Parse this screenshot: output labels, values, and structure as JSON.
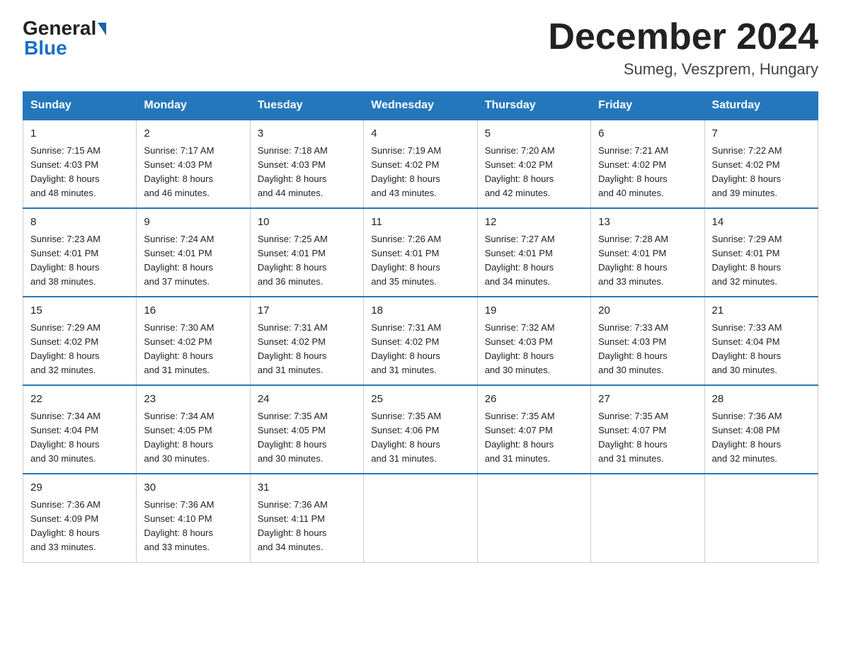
{
  "header": {
    "logo_general": "General",
    "logo_blue": "Blue",
    "title": "December 2024",
    "location": "Sumeg, Veszprem, Hungary"
  },
  "days_of_week": [
    "Sunday",
    "Monday",
    "Tuesday",
    "Wednesday",
    "Thursday",
    "Friday",
    "Saturday"
  ],
  "weeks": [
    [
      {
        "day": "1",
        "info": "Sunrise: 7:15 AM\nSunset: 4:03 PM\nDaylight: 8 hours\nand 48 minutes."
      },
      {
        "day": "2",
        "info": "Sunrise: 7:17 AM\nSunset: 4:03 PM\nDaylight: 8 hours\nand 46 minutes."
      },
      {
        "day": "3",
        "info": "Sunrise: 7:18 AM\nSunset: 4:03 PM\nDaylight: 8 hours\nand 44 minutes."
      },
      {
        "day": "4",
        "info": "Sunrise: 7:19 AM\nSunset: 4:02 PM\nDaylight: 8 hours\nand 43 minutes."
      },
      {
        "day": "5",
        "info": "Sunrise: 7:20 AM\nSunset: 4:02 PM\nDaylight: 8 hours\nand 42 minutes."
      },
      {
        "day": "6",
        "info": "Sunrise: 7:21 AM\nSunset: 4:02 PM\nDaylight: 8 hours\nand 40 minutes."
      },
      {
        "day": "7",
        "info": "Sunrise: 7:22 AM\nSunset: 4:02 PM\nDaylight: 8 hours\nand 39 minutes."
      }
    ],
    [
      {
        "day": "8",
        "info": "Sunrise: 7:23 AM\nSunset: 4:01 PM\nDaylight: 8 hours\nand 38 minutes."
      },
      {
        "day": "9",
        "info": "Sunrise: 7:24 AM\nSunset: 4:01 PM\nDaylight: 8 hours\nand 37 minutes."
      },
      {
        "day": "10",
        "info": "Sunrise: 7:25 AM\nSunset: 4:01 PM\nDaylight: 8 hours\nand 36 minutes."
      },
      {
        "day": "11",
        "info": "Sunrise: 7:26 AM\nSunset: 4:01 PM\nDaylight: 8 hours\nand 35 minutes."
      },
      {
        "day": "12",
        "info": "Sunrise: 7:27 AM\nSunset: 4:01 PM\nDaylight: 8 hours\nand 34 minutes."
      },
      {
        "day": "13",
        "info": "Sunrise: 7:28 AM\nSunset: 4:01 PM\nDaylight: 8 hours\nand 33 minutes."
      },
      {
        "day": "14",
        "info": "Sunrise: 7:29 AM\nSunset: 4:01 PM\nDaylight: 8 hours\nand 32 minutes."
      }
    ],
    [
      {
        "day": "15",
        "info": "Sunrise: 7:29 AM\nSunset: 4:02 PM\nDaylight: 8 hours\nand 32 minutes."
      },
      {
        "day": "16",
        "info": "Sunrise: 7:30 AM\nSunset: 4:02 PM\nDaylight: 8 hours\nand 31 minutes."
      },
      {
        "day": "17",
        "info": "Sunrise: 7:31 AM\nSunset: 4:02 PM\nDaylight: 8 hours\nand 31 minutes."
      },
      {
        "day": "18",
        "info": "Sunrise: 7:31 AM\nSunset: 4:02 PM\nDaylight: 8 hours\nand 31 minutes."
      },
      {
        "day": "19",
        "info": "Sunrise: 7:32 AM\nSunset: 4:03 PM\nDaylight: 8 hours\nand 30 minutes."
      },
      {
        "day": "20",
        "info": "Sunrise: 7:33 AM\nSunset: 4:03 PM\nDaylight: 8 hours\nand 30 minutes."
      },
      {
        "day": "21",
        "info": "Sunrise: 7:33 AM\nSunset: 4:04 PM\nDaylight: 8 hours\nand 30 minutes."
      }
    ],
    [
      {
        "day": "22",
        "info": "Sunrise: 7:34 AM\nSunset: 4:04 PM\nDaylight: 8 hours\nand 30 minutes."
      },
      {
        "day": "23",
        "info": "Sunrise: 7:34 AM\nSunset: 4:05 PM\nDaylight: 8 hours\nand 30 minutes."
      },
      {
        "day": "24",
        "info": "Sunrise: 7:35 AM\nSunset: 4:05 PM\nDaylight: 8 hours\nand 30 minutes."
      },
      {
        "day": "25",
        "info": "Sunrise: 7:35 AM\nSunset: 4:06 PM\nDaylight: 8 hours\nand 31 minutes."
      },
      {
        "day": "26",
        "info": "Sunrise: 7:35 AM\nSunset: 4:07 PM\nDaylight: 8 hours\nand 31 minutes."
      },
      {
        "day": "27",
        "info": "Sunrise: 7:35 AM\nSunset: 4:07 PM\nDaylight: 8 hours\nand 31 minutes."
      },
      {
        "day": "28",
        "info": "Sunrise: 7:36 AM\nSunset: 4:08 PM\nDaylight: 8 hours\nand 32 minutes."
      }
    ],
    [
      {
        "day": "29",
        "info": "Sunrise: 7:36 AM\nSunset: 4:09 PM\nDaylight: 8 hours\nand 33 minutes."
      },
      {
        "day": "30",
        "info": "Sunrise: 7:36 AM\nSunset: 4:10 PM\nDaylight: 8 hours\nand 33 minutes."
      },
      {
        "day": "31",
        "info": "Sunrise: 7:36 AM\nSunset: 4:11 PM\nDaylight: 8 hours\nand 34 minutes."
      },
      {
        "day": "",
        "info": ""
      },
      {
        "day": "",
        "info": ""
      },
      {
        "day": "",
        "info": ""
      },
      {
        "day": "",
        "info": ""
      }
    ]
  ]
}
